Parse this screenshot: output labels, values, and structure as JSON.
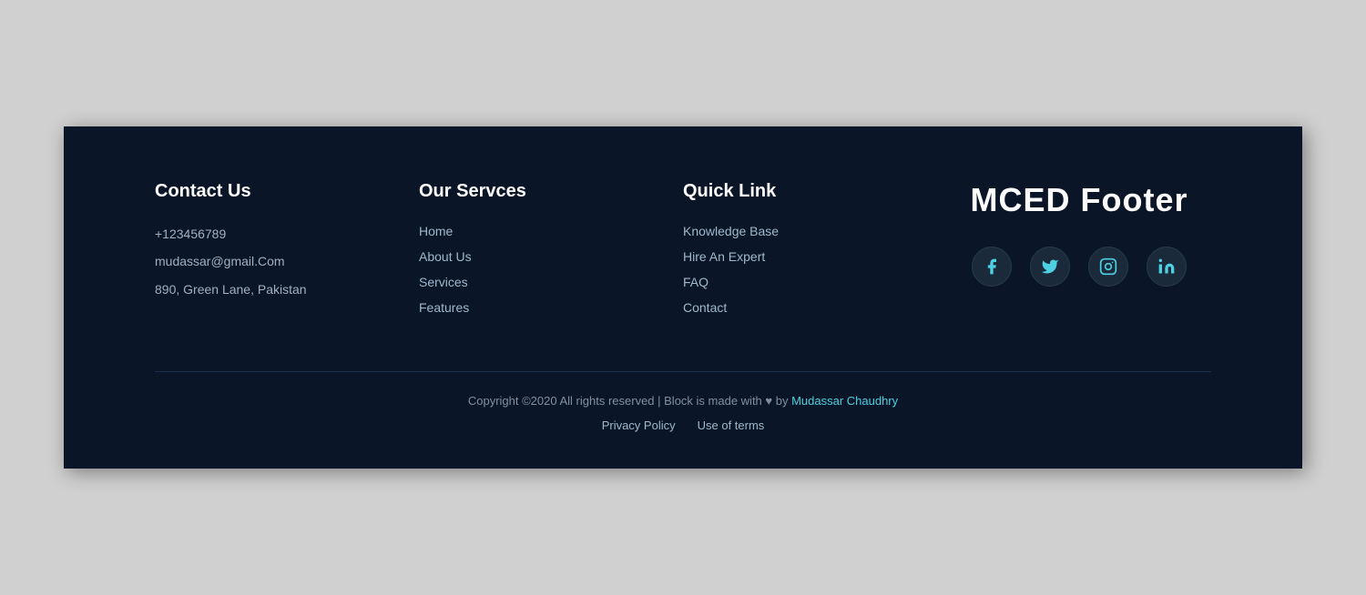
{
  "footer": {
    "contact": {
      "heading": "Contact Us",
      "phone": "+123456789",
      "email": "mudassar@gmail.Com",
      "address": "890, Green Lane, Pakistan"
    },
    "services": {
      "heading": "Our Servces",
      "links": [
        {
          "label": "Home",
          "href": "#"
        },
        {
          "label": "About Us",
          "href": "#"
        },
        {
          "label": "Services",
          "href": "#"
        },
        {
          "label": "Features",
          "href": "#"
        }
      ]
    },
    "quicklink": {
      "heading": "Quick Link",
      "links": [
        {
          "label": "Knowledge Base",
          "href": "#"
        },
        {
          "label": "Hire An Expert",
          "href": "#"
        },
        {
          "label": "FAQ",
          "href": "#"
        },
        {
          "label": "Contact",
          "href": "#"
        }
      ]
    },
    "brand": {
      "title": "MCED Footer"
    },
    "social": {
      "facebook": "facebook-icon",
      "twitter": "twitter-icon",
      "instagram": "instagram-icon",
      "linkedin": "linkedin-icon"
    },
    "bottom": {
      "copyright": "Copyright ©2020 All rights reserved | Block is made with ♥ by ",
      "author": "Mudassar Chaudhry",
      "privacy": "Privacy Policy",
      "terms": "Use of terms"
    }
  }
}
